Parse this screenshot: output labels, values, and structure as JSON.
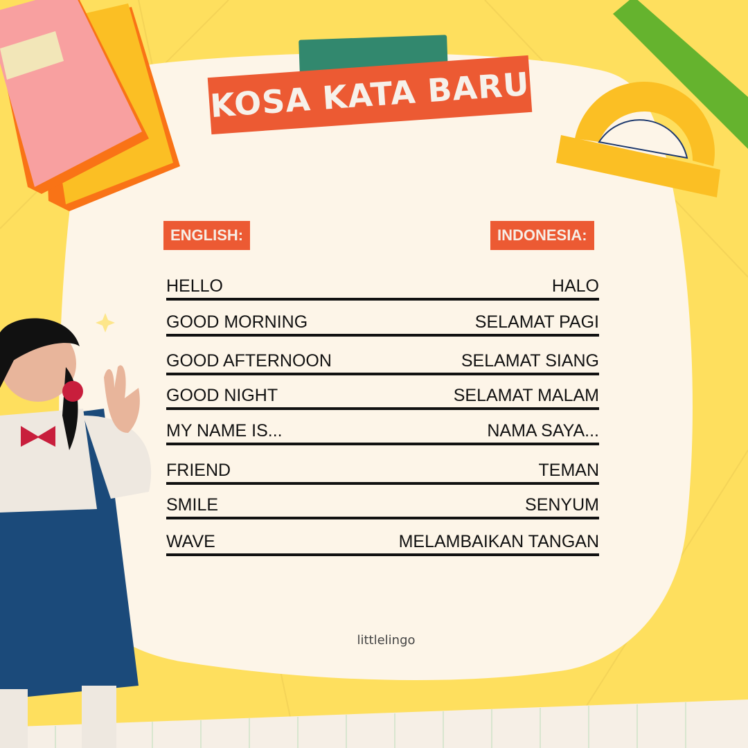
{
  "title": "KOSA KATA BARU",
  "headers": {
    "english": "ENGLISH:",
    "indonesia": "INDONESIA:"
  },
  "vocabulary": [
    {
      "en": "HELLO",
      "id": "HALO"
    },
    {
      "en": "GOOD MORNING",
      "id": "SELAMAT PAGI"
    },
    {
      "en": "GOOD AFTERNOON",
      "id": "SELAMAT SIANG"
    },
    {
      "en": "GOOD NIGHT",
      "id": "SELAMAT MALAM"
    },
    {
      "en": "MY NAME IS...",
      "id": "NAMA SAYA..."
    },
    {
      "en": "FRIEND",
      "id": "TEMAN"
    },
    {
      "en": "SMILE",
      "id": "SENYUM"
    },
    {
      "en": "WAVE",
      "id": "MELAMBAIKAN TANGAN"
    }
  ],
  "footer": "littlelingo",
  "colors": {
    "background": "#FEDF5E",
    "paper": "#FDF5E8",
    "accent": "#EC5A33",
    "tape": "#32886E"
  }
}
